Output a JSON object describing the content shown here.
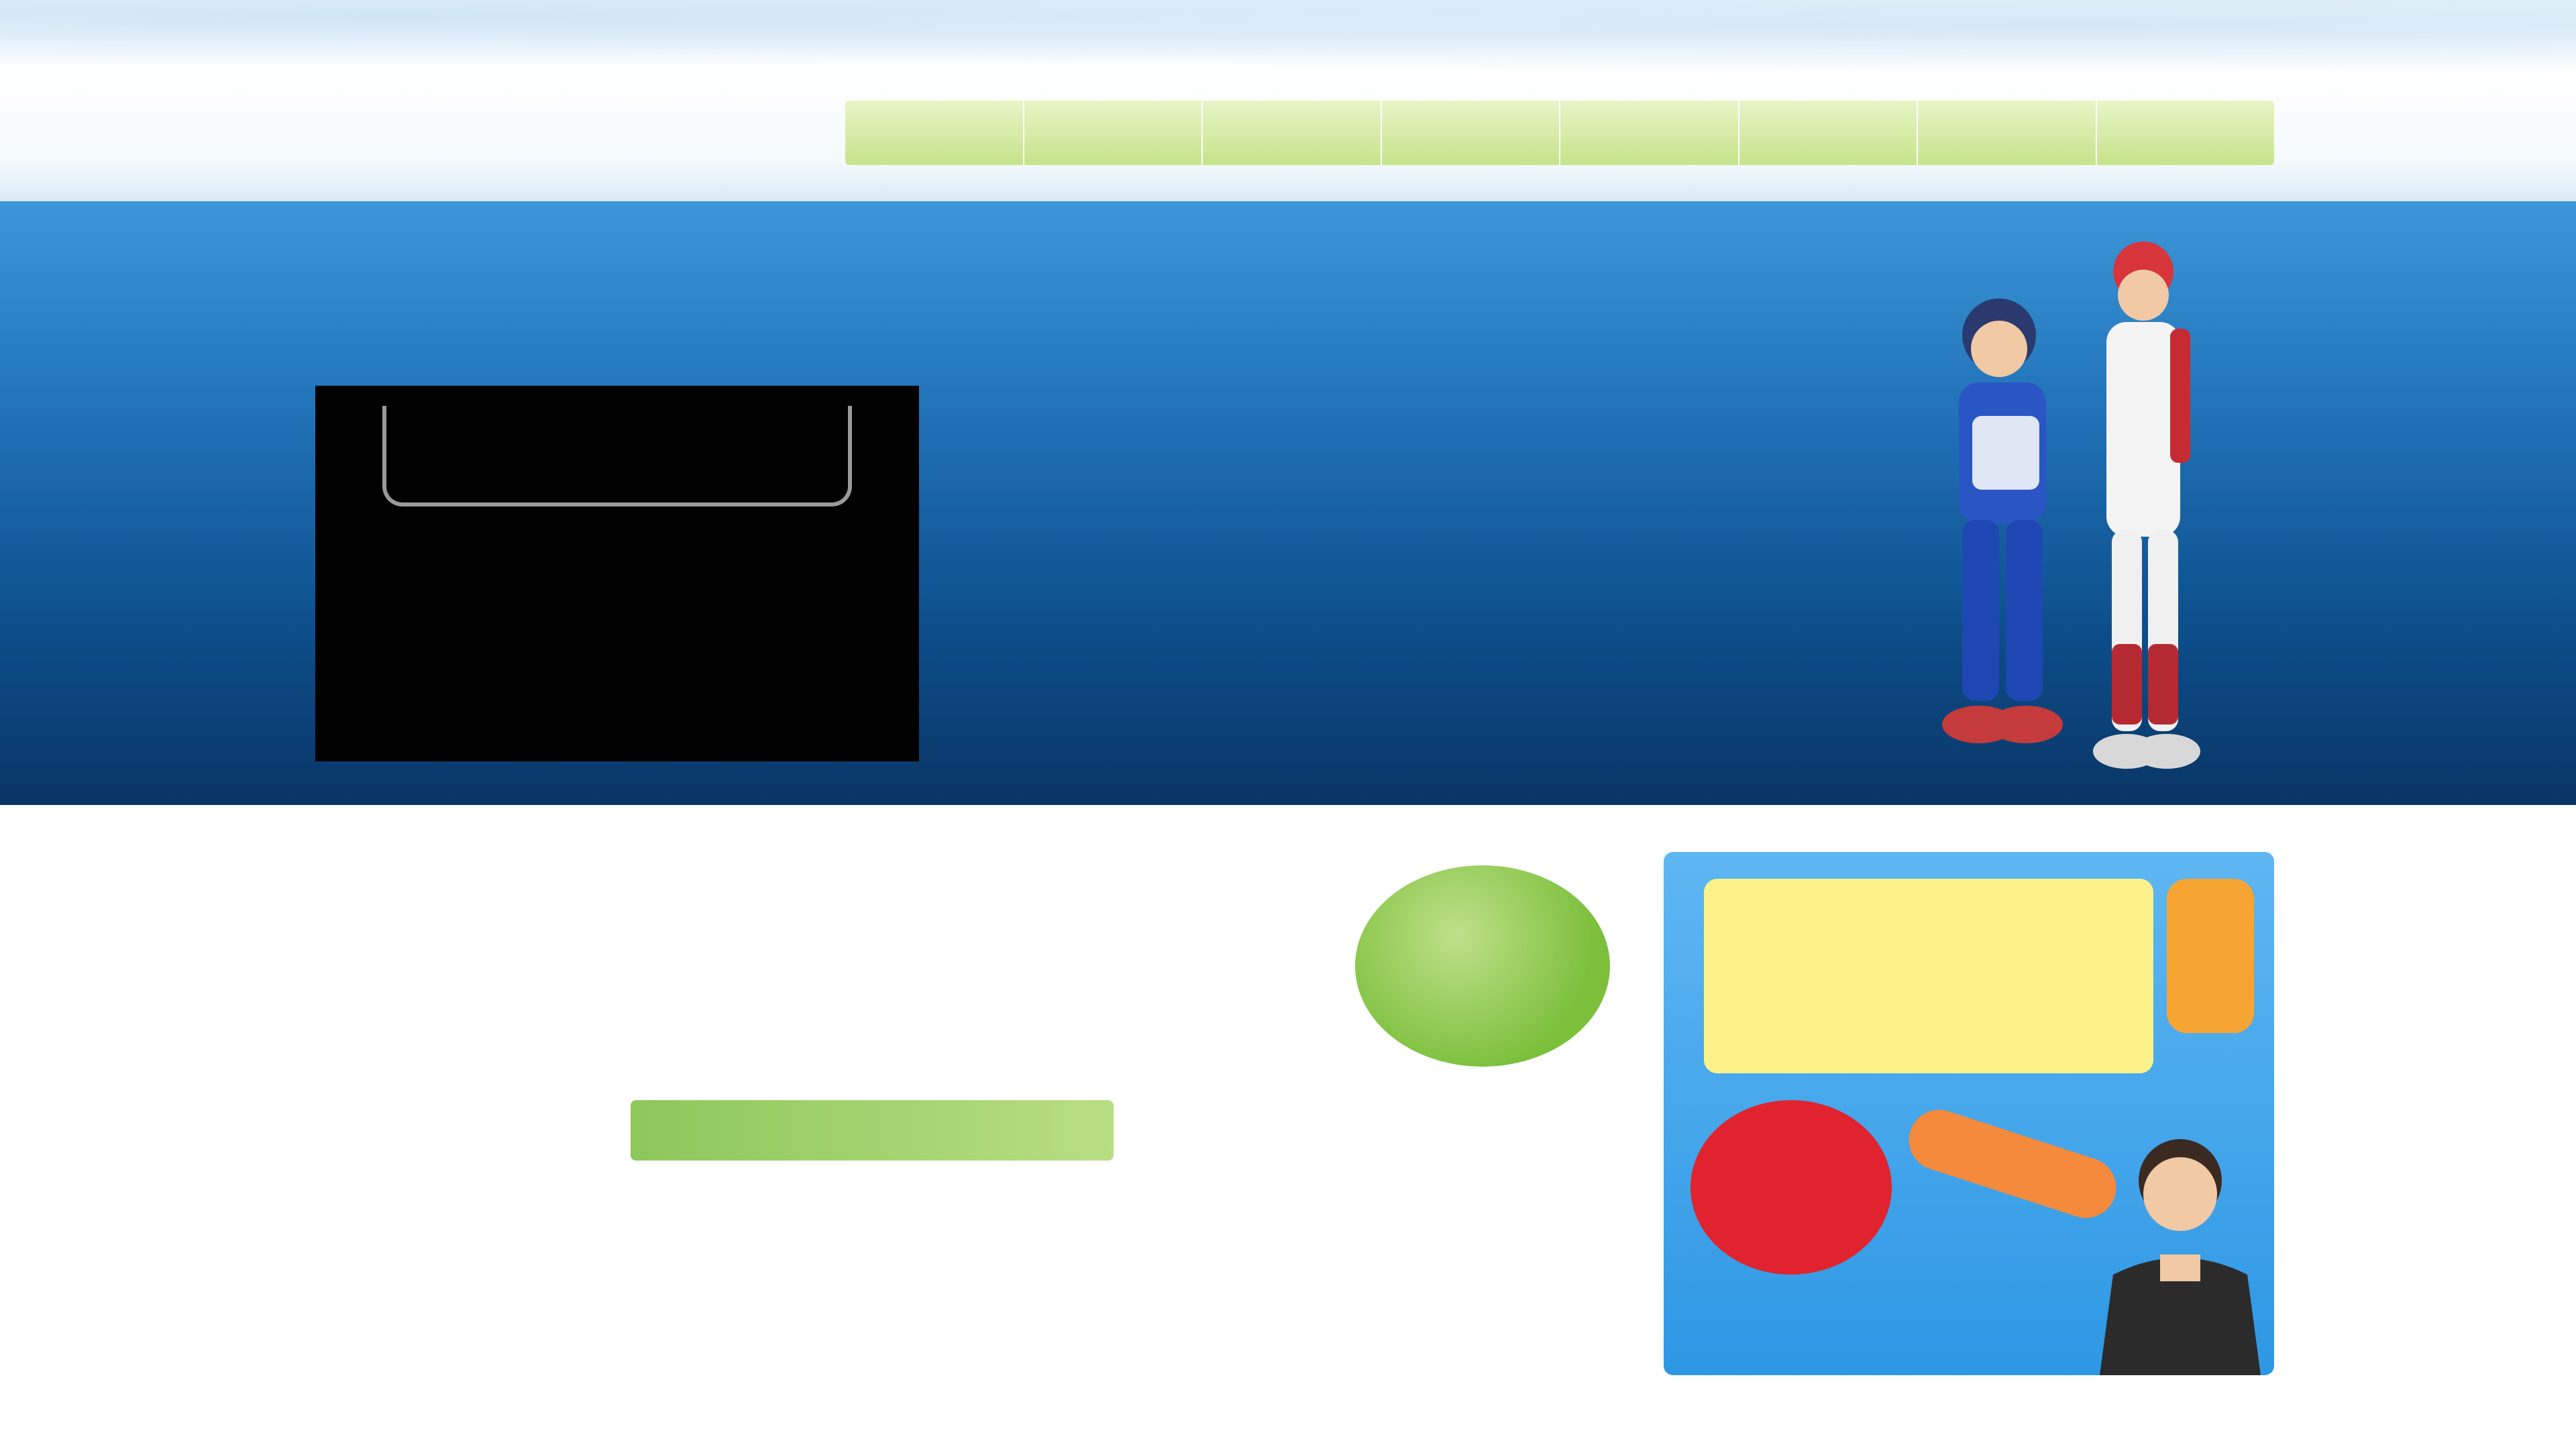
{
  "header": {
    "tagline": "",
    "contact": "",
    "logo": "",
    "nav": [
      "",
      "",
      "",
      "",
      "",
      "",
      "",
      ""
    ]
  },
  "hero": {
    "title": "",
    "slogan": "",
    "video_caption": "",
    "info_heading": "",
    "info_sub": "",
    "info_lines": [
      "",
      "",
      ""
    ]
  },
  "promo": {
    "line1": "",
    "line2": "",
    "badge": "",
    "ribbon": "",
    "note": "",
    "note2": ""
  },
  "side_ad": {
    "callout_title": "",
    "callout_body": "",
    "tag": "",
    "cap_text": ""
  },
  "colors": {
    "hero_blue": "#2172b8",
    "nav_green": "#c6e38a",
    "promo_pink": "#ec5f86",
    "badge_green": "#7bbf3b",
    "ad_blue": "#2e97e4",
    "ad_yellow": "#fdf28a",
    "ad_orange": "#f7a532",
    "cap_red": "#e0232e"
  },
  "icons": {
    "players": "baseball-players-illustration",
    "person": "person-illustration",
    "bat": "bat-icon",
    "cap": "cap-icon"
  }
}
